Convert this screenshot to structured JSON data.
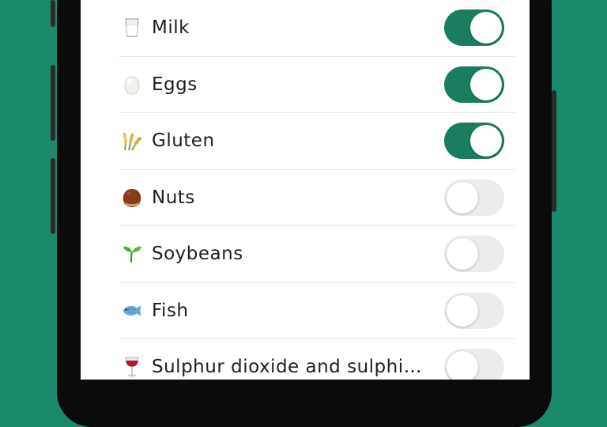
{
  "allergens": [
    {
      "label": "Milk",
      "enabled": true,
      "icon": "milk-glass-icon"
    },
    {
      "label": "Eggs",
      "enabled": true,
      "icon": "egg-icon"
    },
    {
      "label": "Gluten",
      "enabled": true,
      "icon": "wheat-icon"
    },
    {
      "label": "Nuts",
      "enabled": false,
      "icon": "chestnut-icon"
    },
    {
      "label": "Soybeans",
      "enabled": false,
      "icon": "seedling-icon"
    },
    {
      "label": "Fish",
      "enabled": false,
      "icon": "fish-icon"
    },
    {
      "label": "Sulphur dioxide and sulphi…",
      "enabled": false,
      "icon": "wine-glass-icon"
    }
  ],
  "colors": {
    "background": "#1a8a6b",
    "toggle_on": "#1a7d5f",
    "toggle_off": "#ececec"
  }
}
